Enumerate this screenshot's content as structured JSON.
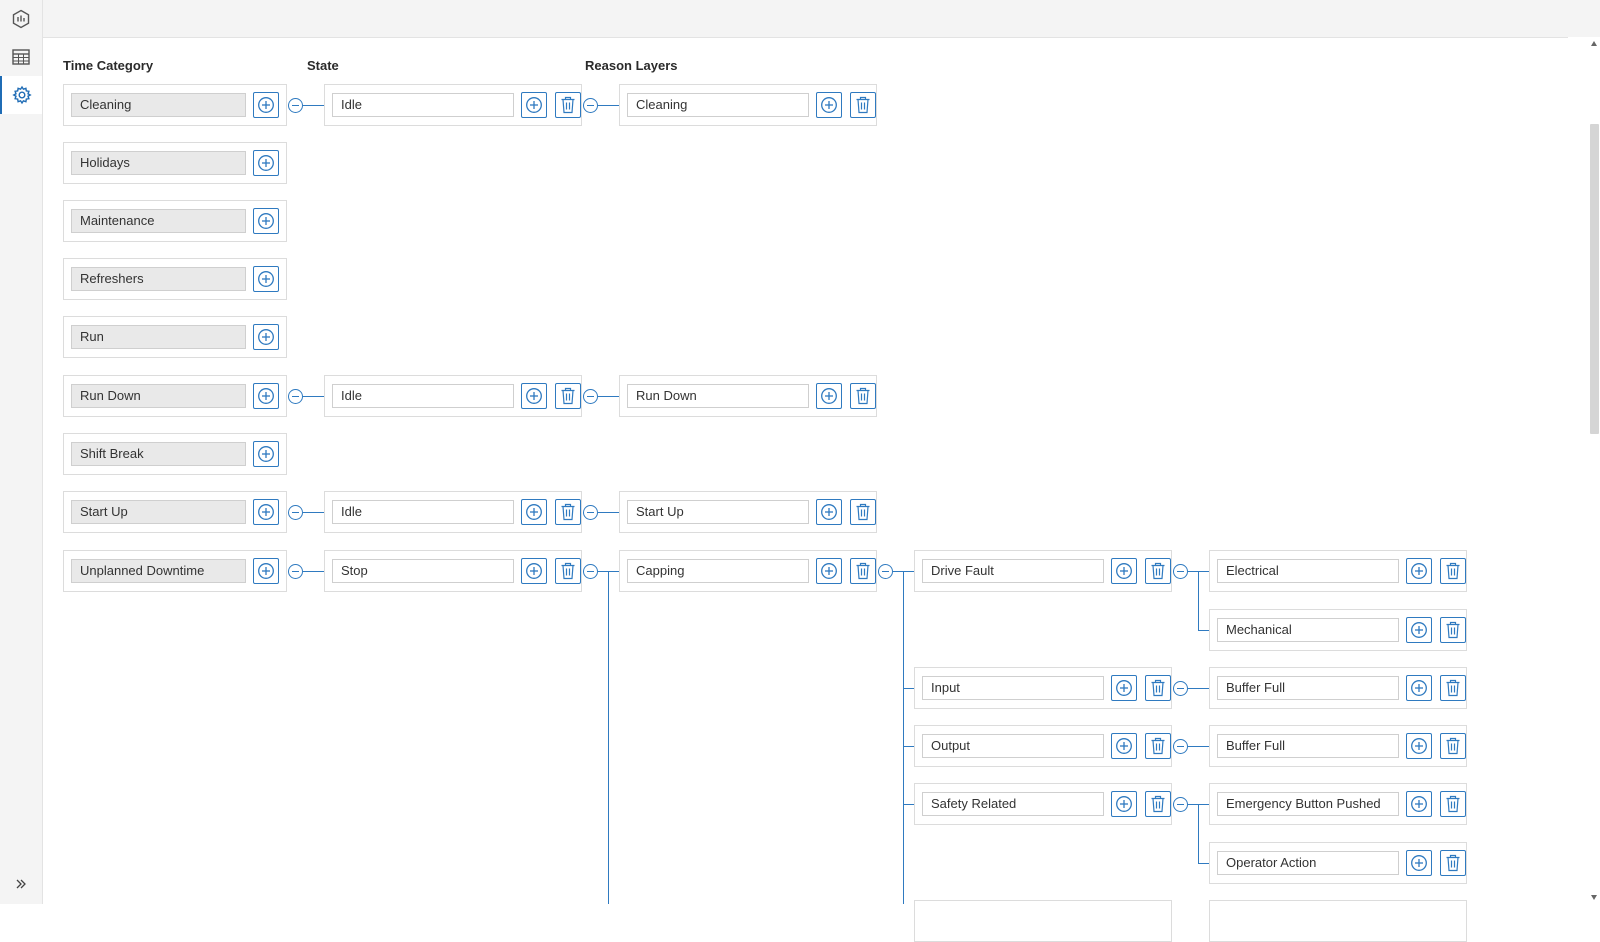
{
  "sidebar": {
    "items": [
      {
        "icon": "hexagon-chart-icon"
      },
      {
        "icon": "table-icon"
      },
      {
        "icon": "gear-icon"
      }
    ],
    "expand_icon": "double-chevron-right-icon"
  },
  "headers": {
    "time_category": "Time Category",
    "state": "State",
    "reason_layers": "Reason Layers"
  },
  "time_categories": [
    "Cleaning",
    "Holidays",
    "Maintenance",
    "Refreshers",
    "Run",
    "Run Down",
    "Shift Break",
    "Start Up",
    "Unplanned Downtime"
  ],
  "states": {
    "cleaning": "Idle",
    "run_down": "Idle",
    "start_up": "Idle",
    "unplanned_downtime": "Stop"
  },
  "reason_layer_1": {
    "cleaning": "Cleaning",
    "run_down": "Run Down",
    "start_up": "Start Up",
    "unplanned_downtime": "Capping"
  },
  "reason_layer_2": [
    "Drive Fault",
    "Input",
    "Output",
    "Safety Related"
  ],
  "reason_layer_3": [
    "Electrical",
    "Mechanical",
    "Buffer Full",
    "Buffer Full",
    "Emergency Button Pushed",
    "Operator Action"
  ],
  "colors": {
    "accent": "#2f7ac0",
    "readonly_field": "#e9e9e9",
    "card_border": "#dcdcdc"
  }
}
